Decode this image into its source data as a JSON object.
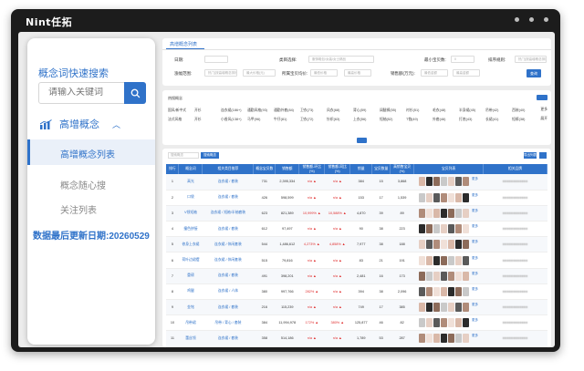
{
  "app": {
    "logo": "Nint任拓"
  },
  "sidebar": {
    "title": "概念词快速搜索",
    "search_placeholder": "请输入关键词",
    "section": "高增概念",
    "items": [
      {
        "label": "高增概念列表",
        "active": true
      },
      {
        "label": "概念随心搜",
        "active": false
      },
      {
        "label": "关注列表",
        "active": false
      }
    ],
    "update_date": "数据最后更新日期:20260529"
  },
  "filters": {
    "tab": "高增概念列表",
    "row1": [
      {
        "label": "日期:",
        "value": ""
      },
      {
        "label": "类目选择:",
        "value": "服饰鞋包/女装/女士精品"
      },
      {
        "label": "最小宝贝数:",
        "value": "0"
      },
      {
        "label": "排序规则:",
        "value": "热门(按高增概念排序)"
      }
    ],
    "row2": [
      {
        "label": "涨幅范围:",
        "value": "热门(按高增概念排序)"
      },
      {
        "label": "",
        "value": "最大价格(元)"
      },
      {
        "label": "所属宝贝均价:",
        "value": "最低价格"
      },
      {
        "label": "",
        "value": "最高价格"
      },
      {
        "label": "销售额(万元):",
        "value": "最低金额"
      },
      {
        "label": "",
        "value": "最高金额"
      }
    ],
    "query_button": "查询"
  },
  "concepts": {
    "label": "热搜概念",
    "row1": [
      "国风/新中式",
      "开衫",
      "连衣裙(186+)",
      "通勤风格(93)",
      "通勤外套(84)",
      "卫衣(73)",
      "风衣(68)",
      "背心(59)",
      "阔腿裤(55)",
      "衬衫(51)",
      "毛衣(48)",
      "半身裙(45)",
      "吊带(42)",
      "西装(40)"
    ],
    "row2": [
      "法式风格",
      "开衫",
      "小香风(138+)",
      "马甲(96)",
      "牛仔(81)",
      "卫衣(72)",
      "针织(63)",
      "上衣(56)",
      "短袖(52)",
      "T恤(49)",
      "外套(46)",
      "打底(43)",
      "长裙(41)",
      "短裤(38)"
    ],
    "tags": [
      "更多",
      "展开"
    ]
  },
  "table": {
    "search_placeholder": "搜索概念",
    "search_button": "搜索概念",
    "export_button": "导出列表",
    "headers": [
      "排行",
      "概念词",
      "相关类目推荐",
      "概念宝贝数",
      "销售额",
      "销售额-环比(%)",
      "销售额-同比(%)",
      "销量",
      "宝贝数量",
      "高销售宝贝(%)",
      "宝贝列表",
      "相关品牌"
    ],
    "rows": [
      {
        "rank": "1",
        "word": "高光",
        "cat": "连衣裙 / 套装",
        "count": "731",
        "sales": "2,395,334",
        "mom": "n/a",
        "yoy": "n/a",
        "vol": "384",
        "items": "15",
        "rate": "3,868"
      },
      {
        "rank": "2",
        "word": "口袋",
        "cat": "连衣裙 / 套装",
        "count": "426",
        "sales": "598,599",
        "mom": "n/a",
        "yoy": "n/a",
        "vol": "153",
        "items": "17",
        "rate": "1,539"
      },
      {
        "rank": "3",
        "word": "V领短袖",
        "cat": "连衣裙 / 短袖/半袖套装",
        "count": "623",
        "sales": "821,389",
        "mom": "10,999%",
        "yoy": "10,588%",
        "vol": "4,870",
        "items": "39",
        "rate": "89"
      },
      {
        "rank": "4",
        "word": "撞色拼接",
        "cat": "连衣裙 / 套装",
        "count": "612",
        "sales": "97,497",
        "mom": "n/a",
        "yoy": "n/a",
        "vol": "90",
        "items": "38",
        "rate": "223"
      },
      {
        "rank": "5",
        "word": "修身上衣裙",
        "cat": "连衣裙 / 休闲套装",
        "count": "544",
        "sales": "1,486,612",
        "mom": "4,273%",
        "yoy": "4,858%",
        "vol": "7,977",
        "items": "38",
        "rate": "188"
      },
      {
        "rank": "6",
        "word": "荷叶边裙摆",
        "cat": "连衣裙 / 休闲套装",
        "count": "515",
        "sales": "79,816",
        "mom": "n/a",
        "yoy": "n/a",
        "vol": "83",
        "items": "21",
        "rate": "191"
      },
      {
        "rank": "7",
        "word": "重磅",
        "cat": "连衣裙 / 套装",
        "count": "491",
        "sales": "398,201",
        "mom": "n/a",
        "yoy": "n/a",
        "vol": "2,481",
        "items": "16",
        "rate": "173"
      },
      {
        "rank": "8",
        "word": "鸡腿",
        "cat": "连衣裙 / 人体",
        "count": "380",
        "sales": "997,766",
        "mom": "282%",
        "yoy": "n/a",
        "vol": "394",
        "items": "38",
        "rate": "2,096"
      },
      {
        "rank": "9",
        "word": "金铭",
        "cat": "连衣裙 / 套装",
        "count": "216",
        "sales": "115,239",
        "mom": "n/a",
        "yoy": "n/a",
        "vol": "749",
        "items": "17",
        "rate": "385"
      },
      {
        "rank": "10",
        "word": "吊带裙",
        "cat": "吊带 / 背心 / 套装",
        "count": "384",
        "sales": "11,994,978",
        "mom": "172%",
        "yoy": "380%",
        "vol": "125,877",
        "items": "46",
        "rate": "82"
      },
      {
        "rank": "11",
        "word": "蕾丝领",
        "cat": "连衣裙 / 套装",
        "count": "358",
        "sales": "514,186",
        "mom": "n/a",
        "yoy": "n/a",
        "vol": "1,789",
        "items": "53",
        "rate": "287"
      },
      {
        "rank": "12",
        "word": "条纹",
        "cat": "连衣裙 / 套装",
        "count": "353",
        "sales": "58,419",
        "mom": "n/a",
        "yoy": "n/a",
        "vol": "174",
        "items": "21",
        "rate": "188"
      }
    ]
  },
  "colors": {
    "accent": "#2f72c9",
    "up": "#e03131"
  }
}
